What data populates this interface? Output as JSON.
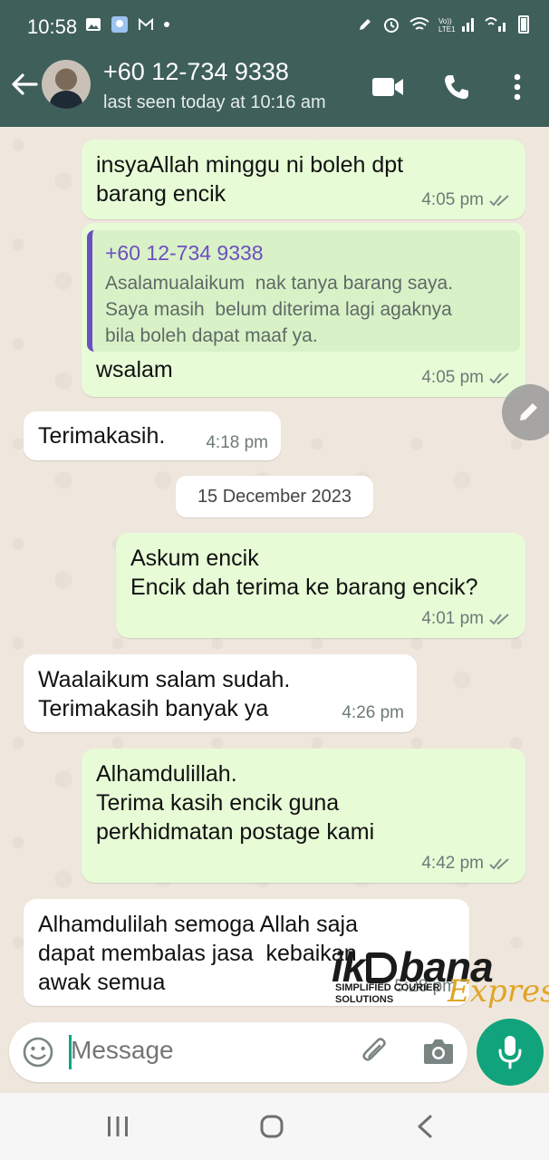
{
  "status_bar": {
    "time": "10:58"
  },
  "header": {
    "contact_name": "+60 12-734 9338",
    "last_seen": "last seen today at 10:16 am"
  },
  "messages": [
    {
      "direction": "out",
      "text": "insyaAllah minggu ni boleh dpt\nbarang encik",
      "time": "4:05 pm",
      "status": "read"
    },
    {
      "direction": "out",
      "quoted_name": "+60 12-734 9338",
      "quoted_text": "Asalamualaikum  nak tanya barang saya.\nSaya masih  belum diterima lagi agaknya\nbila boleh dapat maaf ya.",
      "text": "wsalam",
      "time": "4:05 pm",
      "status": "read"
    },
    {
      "direction": "in",
      "text": "Terimakasih.",
      "time": "4:18 pm"
    },
    {
      "direction": "out",
      "text": "Askum encik\nEncik dah terima ke barang encik?",
      "time": "4:01 pm",
      "status": "read"
    },
    {
      "direction": "in",
      "text": "Waalaikum salam sudah.\nTerimakasih banyak ya",
      "time": "4:26 pm"
    },
    {
      "direction": "out",
      "text": "Alhamdulillah.\nTerima kasih encik guna\nperkhidmatan postage kami",
      "time": "4:42 pm",
      "status": "read"
    },
    {
      "direction": "in",
      "text": "Alhamdulilah semoga Allah saja\ndapat membalas jasa  kebaikan\nawak semua",
      "time": "5:28 pm"
    }
  ],
  "date_divider": "15 December 2023",
  "watermark": {
    "brand": "ikobana",
    "tagline": "SIMPLIFIED COURIER\nSOLUTIONS",
    "express": "Express"
  },
  "composer": {
    "placeholder": "Message"
  },
  "colors": {
    "header": "#3f5f5a",
    "outgoing_bubble": "#e7fcd6",
    "accent": "#11a47c",
    "quote_bar": "#6c4fc1"
  },
  "icons": [
    "back-arrow-icon",
    "video-call-icon",
    "phone-icon",
    "more-icon",
    "emoji-icon",
    "attach-icon",
    "camera-icon",
    "mic-icon",
    "edit-icon"
  ]
}
